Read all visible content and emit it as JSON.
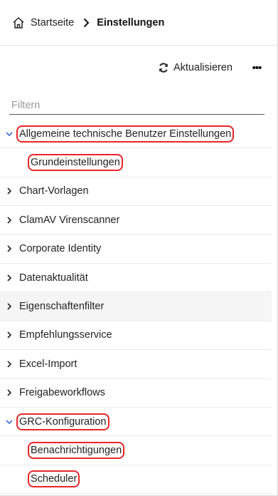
{
  "breadcrumb": {
    "home": "Startseite",
    "current": "Einstellungen"
  },
  "toolbar": {
    "refresh_label": "Aktualisieren",
    "more_label": "•••"
  },
  "filter": {
    "placeholder": "Filtern",
    "value": ""
  },
  "tree": {
    "items": [
      {
        "label": "Allgemeine technische Benutzer Einstellungen",
        "expanded": true,
        "highlighted": true
      },
      {
        "label": "Grundeinstellungen",
        "child": true,
        "highlighted": true
      },
      {
        "label": "Chart-Vorlagen",
        "expanded": false
      },
      {
        "label": "ClamAV Virenscanner",
        "expanded": false
      },
      {
        "label": "Corporate Identity",
        "expanded": false
      },
      {
        "label": "Datenaktualität",
        "expanded": false
      },
      {
        "label": "Eigenschaftenfilter",
        "expanded": false,
        "hover": true
      },
      {
        "label": "Empfehlungsservice",
        "expanded": false
      },
      {
        "label": "Excel-Import",
        "expanded": false
      },
      {
        "label": "Freigabeworkflows",
        "expanded": false
      },
      {
        "label": "GRC-Konfiguration",
        "expanded": true,
        "highlighted": true
      },
      {
        "label": "Benachrichtigungen",
        "child": true,
        "highlighted": true
      },
      {
        "label": "Scheduler",
        "child": true,
        "highlighted": true
      }
    ]
  },
  "colors": {
    "highlight": "#e8262a",
    "expanded_chevron": "#3b6fd6",
    "hover_row": "#f5f5f5"
  }
}
